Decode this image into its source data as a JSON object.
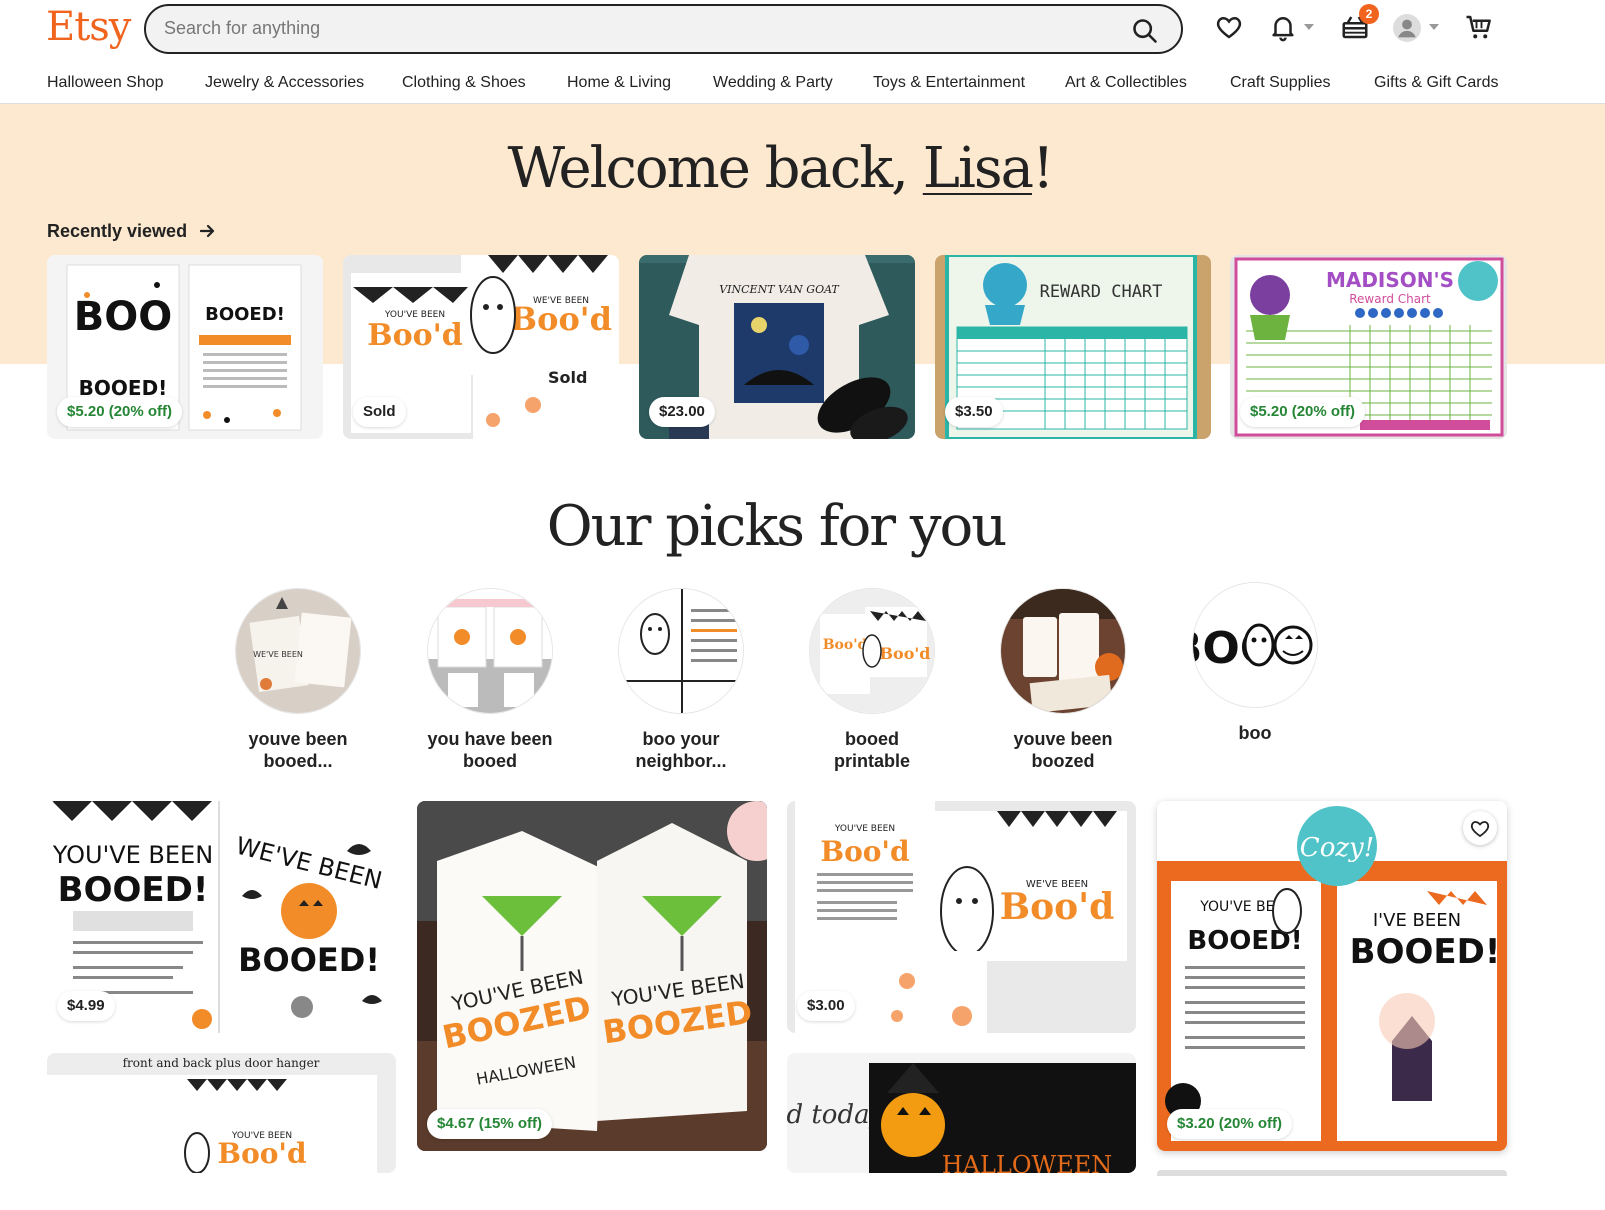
{
  "header": {
    "logo": "Etsy",
    "search_placeholder": "Search for anything",
    "cart_badge": "2",
    "icons": [
      "search-icon",
      "heart-icon",
      "bell-icon",
      "gift-basket-icon",
      "avatar-icon",
      "cart-icon"
    ]
  },
  "nav": {
    "items": [
      "Halloween Shop",
      "Jewelry & Accessories",
      "Clothing & Shoes",
      "Home & Living",
      "Wedding & Party",
      "Toys & Entertainment",
      "Art & Collectibles",
      "Craft Supplies",
      "Gifts & Gift Cards"
    ]
  },
  "hero": {
    "greeting": "Welcome back, ",
    "name": "Lisa",
    "punct": "!"
  },
  "recently_viewed": {
    "title": "Recently viewed",
    "items": [
      {
        "price": "$5.20 (20% off)",
        "sale": true
      },
      {
        "price": "Sold",
        "sale": false
      },
      {
        "price": "$23.00",
        "sale": false
      },
      {
        "price": "$3.50",
        "sale": false
      },
      {
        "price": "$5.20 (20% off)",
        "sale": true
      }
    ]
  },
  "picks": {
    "title": "Our picks for you",
    "circles": [
      {
        "line1": "youve been",
        "line2": "booed..."
      },
      {
        "line1": "you have been",
        "line2": "booed"
      },
      {
        "line1": "boo your",
        "line2": "neighbor..."
      },
      {
        "line1": "booed",
        "line2": "printable"
      },
      {
        "line1": "youve been",
        "line2": "boozed"
      },
      {
        "line1": "boo",
        "line2": ""
      }
    ],
    "listings": [
      {
        "price": "$4.99",
        "sale": false
      },
      {
        "price": "$4.67 (15% off)",
        "sale": true
      },
      {
        "price": "$3.00",
        "sale": false
      },
      {
        "price": "$3.20 (20% off)",
        "sale": true
      }
    ]
  },
  "image_text": {
    "boo_word": "BOO",
    "booed": "BOOED!",
    "youve_been": "YOU'VE BEEN",
    "weve_been": "WE'VE BEEN",
    "bood": "Boo'd",
    "boozed": "BOOZED",
    "vincent": "VINCENT VAN GOAT",
    "reward_chart": "REWARD CHART",
    "madison": "MADISON'S",
    "madison_sub": "Reward Chart",
    "front_back": "front and back plus door hanger",
    "cozy": "Cozy!",
    "halloween": "HALLOWEEN",
    "and_today": "nd today",
    "ive_been": "I'VE BEEN"
  }
}
